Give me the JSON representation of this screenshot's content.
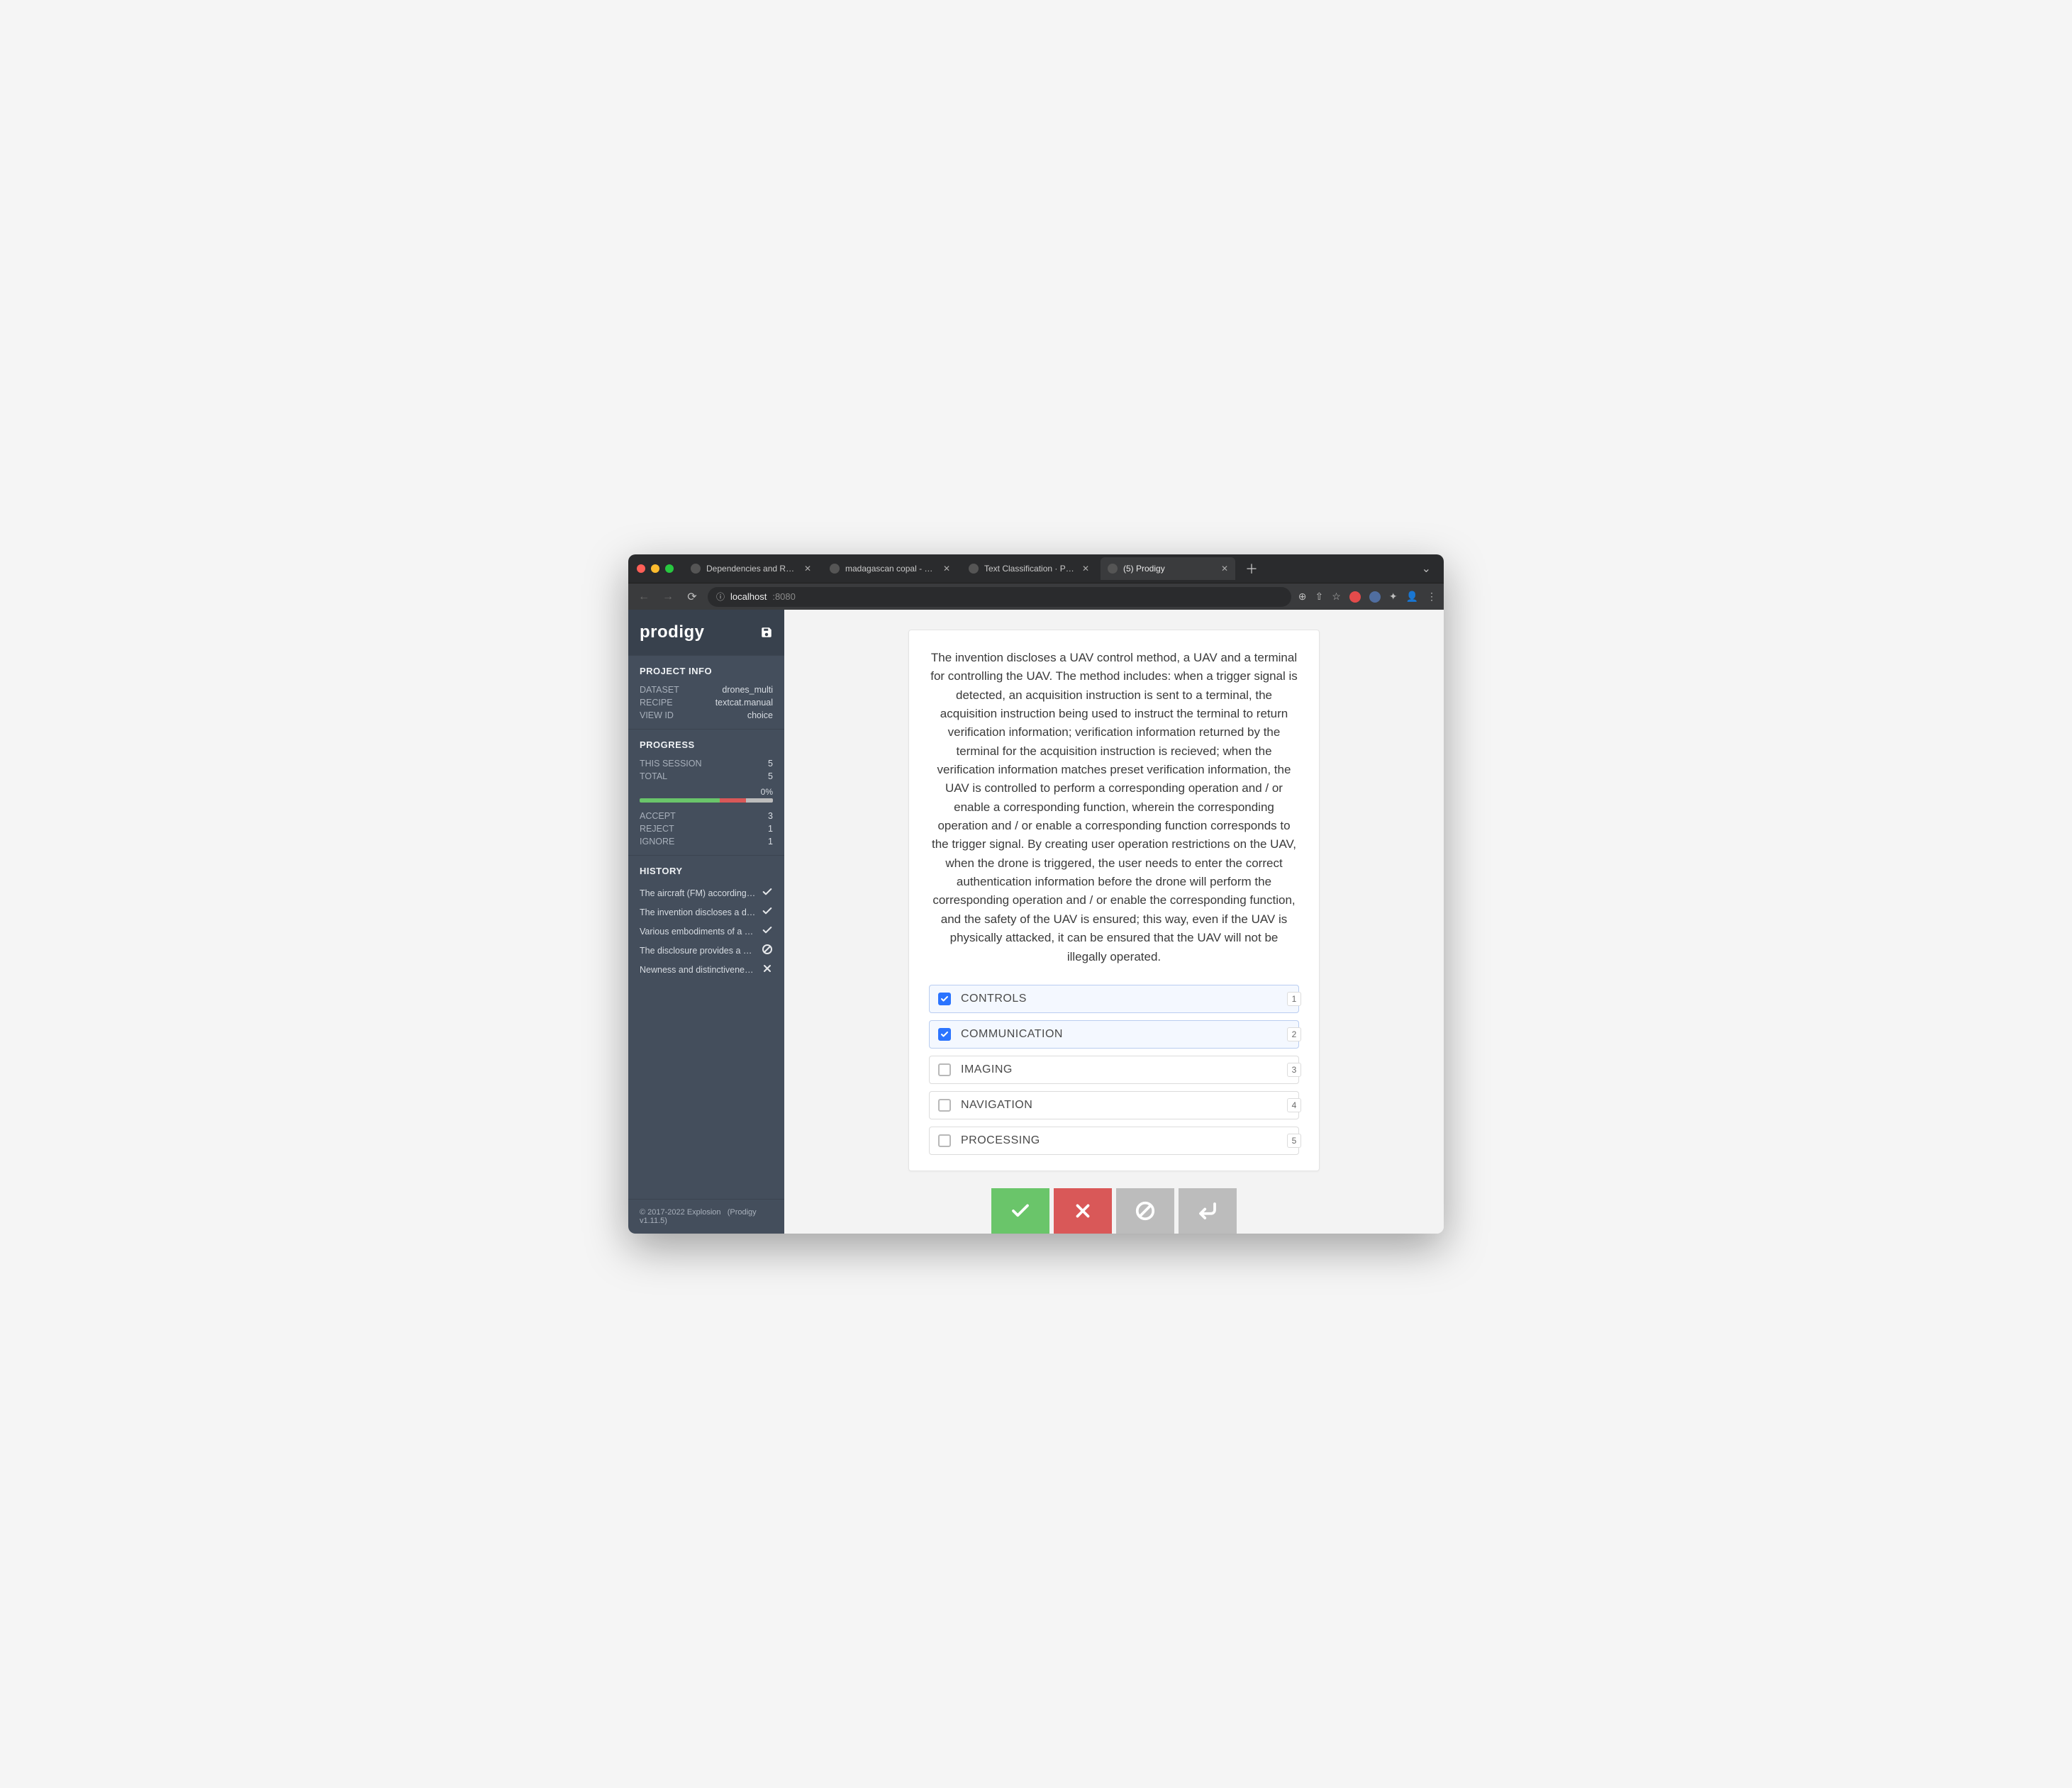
{
  "browser": {
    "tabs": [
      {
        "label": "Dependencies and Relations · P",
        "active": false
      },
      {
        "label": "madagascan copal - Google Se",
        "active": false
      },
      {
        "label": "Text Classification · Prodigy · A",
        "active": false
      },
      {
        "label": "(5) Prodigy",
        "active": true
      }
    ],
    "url_host": "localhost",
    "url_path": ":8080"
  },
  "brand": "prodigy",
  "project_info": {
    "heading": "PROJECT INFO",
    "dataset_label": "DATASET",
    "dataset_value": "drones_multi",
    "recipe_label": "RECIPE",
    "recipe_value": "textcat.manual",
    "viewid_label": "VIEW ID",
    "viewid_value": "choice"
  },
  "progress": {
    "heading": "PROGRESS",
    "session_label": "THIS SESSION",
    "session_value": "5",
    "total_label": "TOTAL",
    "total_value": "5",
    "pct": "0%",
    "accept_label": "ACCEPT",
    "accept_value": "3",
    "reject_label": "REJECT",
    "reject_value": "1",
    "ignore_label": "IGNORE",
    "ignore_value": "1",
    "bar": {
      "accept_pct": 60,
      "reject_pct": 20,
      "ignore_pct": 20
    }
  },
  "history": {
    "heading": "HISTORY",
    "items": [
      {
        "text": "The aircraft (FM) according to …",
        "status": "accept"
      },
      {
        "text": "The invention discloses a drivi…",
        "status": "accept"
      },
      {
        "text": "Various embodiments of a syst…",
        "status": "accept"
      },
      {
        "text": "The disclosure provides a syst…",
        "status": "ignore"
      },
      {
        "text": "Newness and distinctiveness i…",
        "status": "reject"
      }
    ]
  },
  "footer": {
    "copyright": "© 2017-2022 Explosion",
    "product": "(Prodigy v1.11.5)"
  },
  "task": {
    "text": "The invention discloses a UAV control method, a UAV and a terminal for controlling the UAV. The method includes: when a trigger signal is detected, an acquisition instruction is sent to a terminal, the acquisition instruction being used to instruct the terminal to return verification information; verification information returned by the terminal for the acquisition instruction is recieved; when the verification information matches preset verification information, the UAV is controlled to perform a corresponding operation and / or enable a corresponding function, wherein the corresponding operation and / or enable a corresponding function corresponds to the trigger signal. By creating user operation restrictions on the UAV, when the drone is triggered, the user needs to enter the correct authentication information before the drone will perform the corresponding operation and / or enable the corresponding function, and the safety of the UAV is ensured; this way, even if the UAV is physically attacked, it can be ensured that the UAV will not be illegally operated."
  },
  "choices": [
    {
      "label": "CONTROLS",
      "selected": true,
      "key": "1"
    },
    {
      "label": "COMMUNICATION",
      "selected": true,
      "key": "2"
    },
    {
      "label": "IMAGING",
      "selected": false,
      "key": "3"
    },
    {
      "label": "NAVIGATION",
      "selected": false,
      "key": "4"
    },
    {
      "label": "PROCESSING",
      "selected": false,
      "key": "5"
    }
  ]
}
